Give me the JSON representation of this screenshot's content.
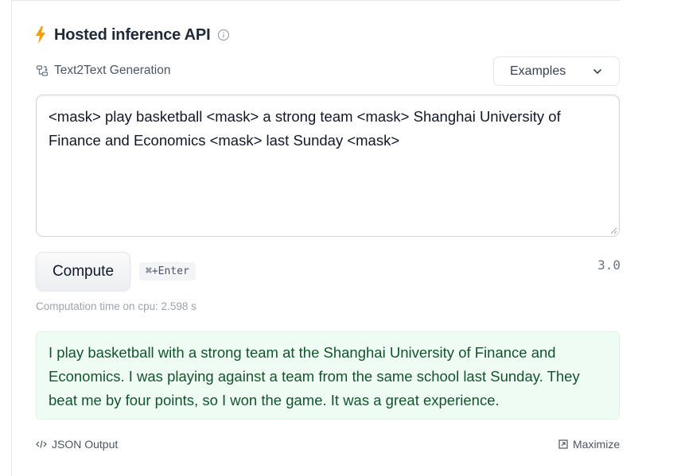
{
  "header": {
    "title": "Hosted inference API",
    "icons": {
      "lead": "lightning-bolt-icon",
      "info": "info-icon"
    },
    "colors": {
      "bolt": "#f59e0b"
    }
  },
  "task": {
    "label": "Text2Text Generation",
    "icon": "text2text-task-icon"
  },
  "examples": {
    "label": "Examples",
    "icon": "chevron-down-icon"
  },
  "input": {
    "value": "<mask> play basketball <mask> a strong team <mask> Shanghai University of Finance and Economics <mask> last Sunday <mask>"
  },
  "actions": {
    "compute_label": "Compute",
    "shortcut": "⌘+Enter",
    "version": "3.0"
  },
  "status": {
    "computation_time": "Computation time on cpu: 2.598 s"
  },
  "output": {
    "text": "I play basketball with a strong team at the Shanghai University of Finance and Economics. I was playing against a team from the same school last Sunday. They beat me by four points, so I won the game. It was a great experience.",
    "colors": {
      "background": "#effcf4",
      "text": "#14532d"
    }
  },
  "footer": {
    "json_label": "JSON Output",
    "maximize_label": "Maximize"
  }
}
